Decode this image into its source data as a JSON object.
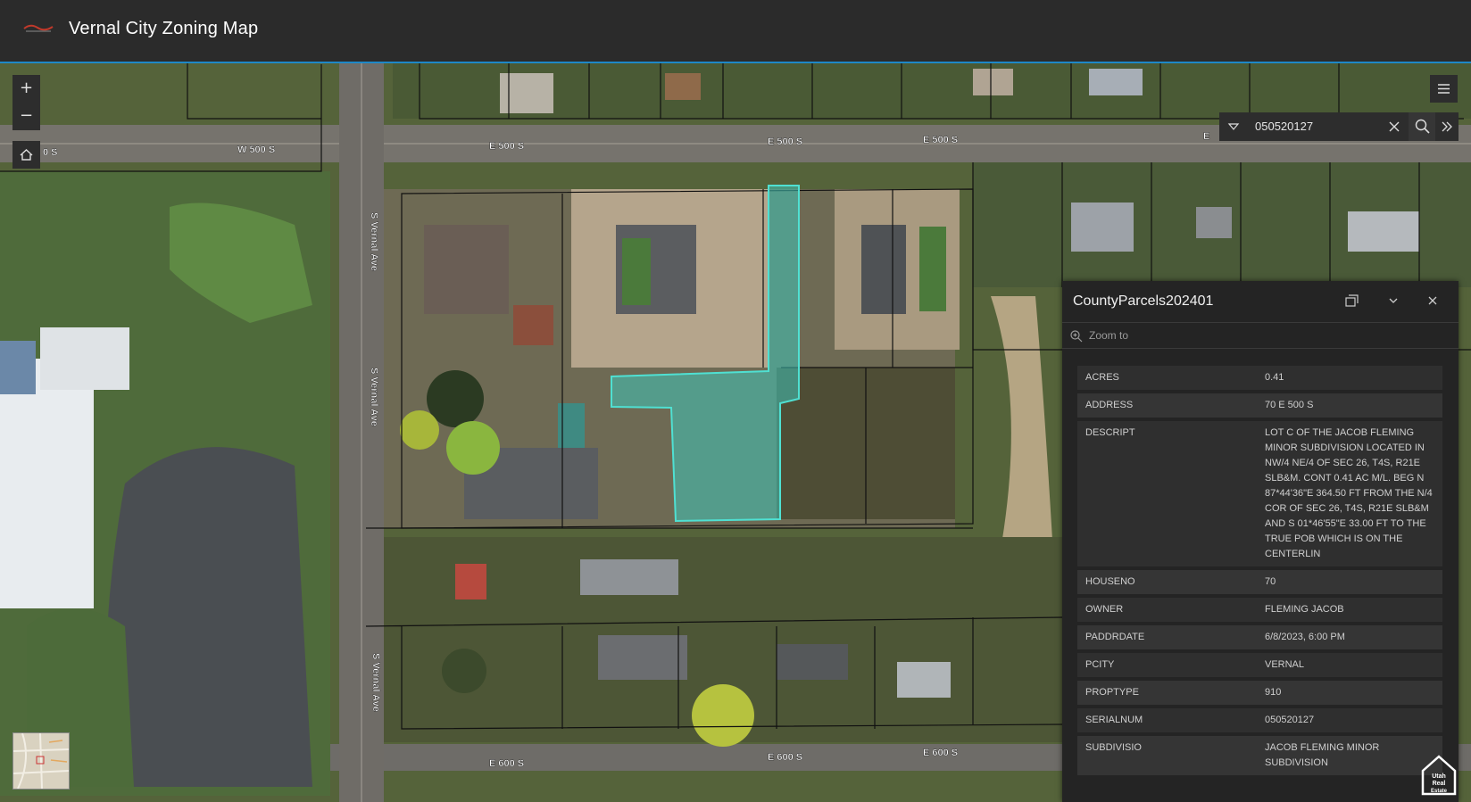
{
  "header": {
    "title": "Vernal City Zoning Map"
  },
  "map": {
    "street_labels": {
      "w500s": "W 500 S",
      "e500s_a": "E 500 S",
      "e500s_b": "E 500 S",
      "e500s_c": "E 500 S",
      "e500s_d": "E",
      "w500s_left": "0 S",
      "svernal_a": "S Vernal Ave",
      "svernal_b": "S Vernal Ave",
      "svernal_c": "S Vernal Ave",
      "e600s_a": "E 600 S",
      "e600s_b": "E 600 S",
      "e600s_c": "E 600 S"
    },
    "highlight_color": "#3fc4b8",
    "accent_color": "#1e88c7"
  },
  "controls": {
    "zoom_in": "+",
    "zoom_out": "−"
  },
  "search": {
    "value": "050520127"
  },
  "popup": {
    "title": "CountyParcels202401",
    "zoom_to": "Zoom to",
    "fields": [
      {
        "key": "ACRES",
        "value": "0.41"
      },
      {
        "key": "ADDRESS",
        "value": "70 E 500 S"
      },
      {
        "key": "DESCRIPT",
        "value": "LOT C OF THE JACOB FLEMING MINOR SUBDIVISION LOCATED IN NW/4 NE/4 OF SEC 26, T4S, R21E SLB&M. CONT 0.41 AC M/L. BEG N 87*44'36\"E 364.50 FT FROM THE N/4 COR OF SEC 26, T4S, R21E SLB&M AND S 01*46'55\"E 33.00 FT TO THE TRUE POB WHICH IS ON THE CENTERLIN"
      },
      {
        "key": "HOUSENO",
        "value": "70"
      },
      {
        "key": "OWNER",
        "value": "FLEMING JACOB"
      },
      {
        "key": "PADDRDATE",
        "value": "6/8/2023, 6:00 PM"
      },
      {
        "key": "PCITY",
        "value": "VERNAL"
      },
      {
        "key": "PROPTYPE",
        "value": "910"
      },
      {
        "key": "SERIALNUM",
        "value": "050520127"
      },
      {
        "key": "SUBDIVISIO",
        "value": "JACOB FLEMING MINOR SUBDIVISION"
      }
    ]
  },
  "watermark": {
    "text": "Utah Real Estate .com"
  }
}
